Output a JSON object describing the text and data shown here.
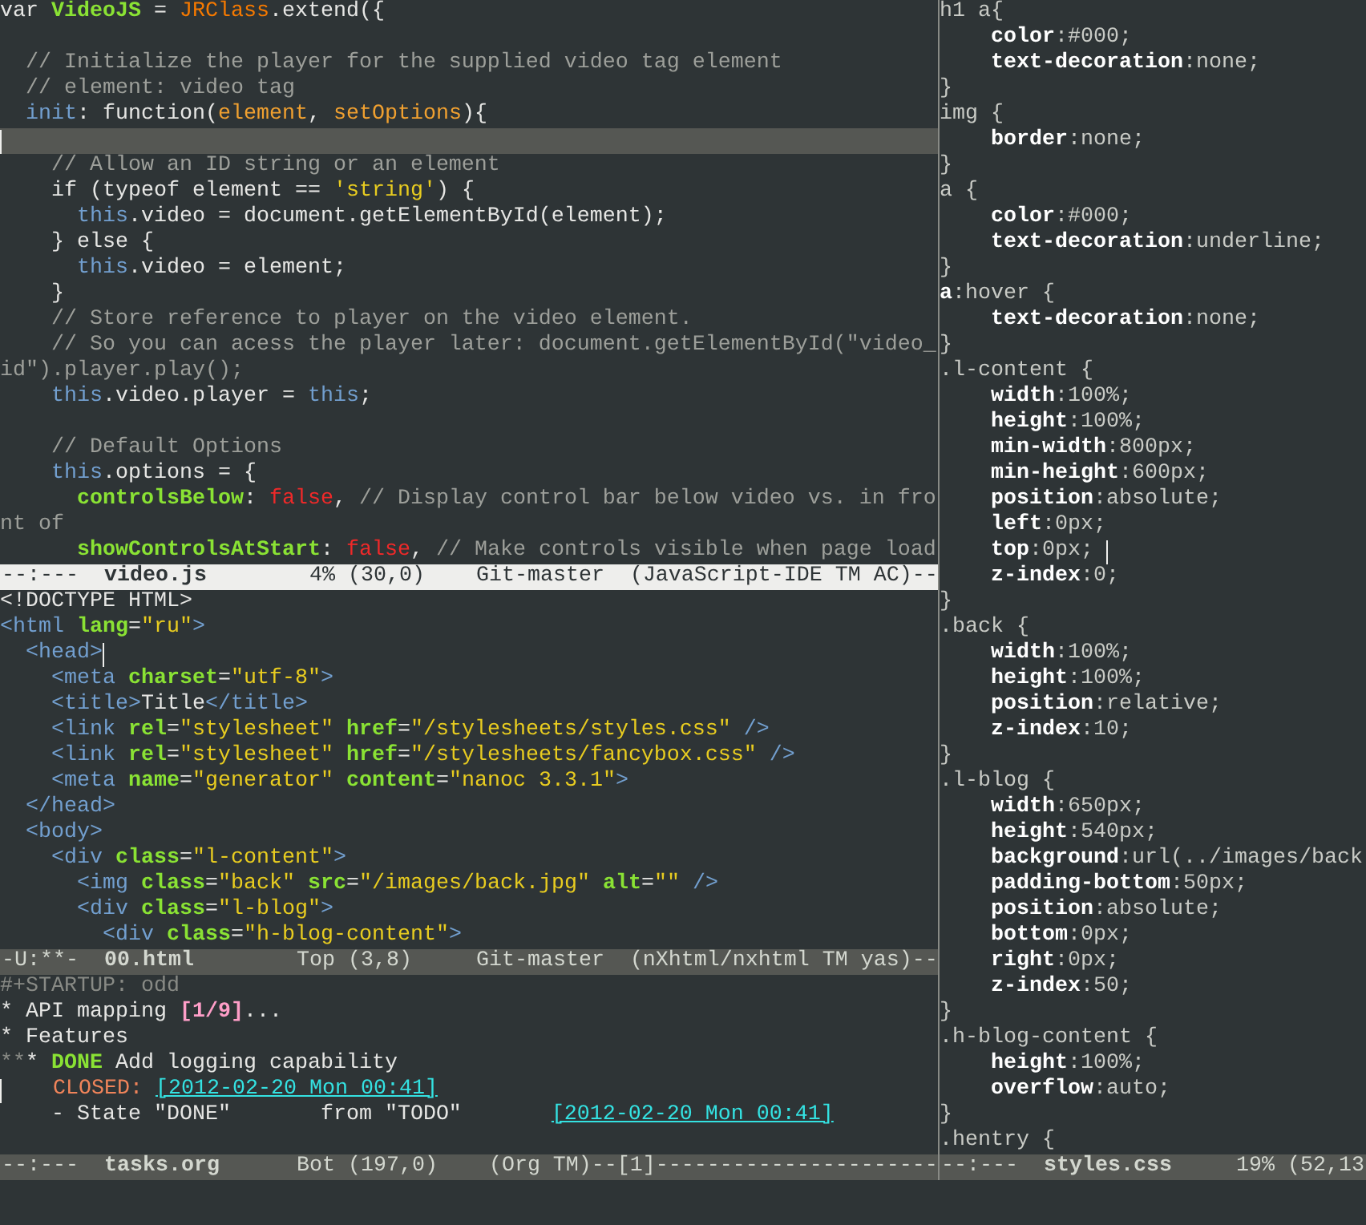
{
  "left_column": [
    {
      "lines": [
        {
          "kind": "code",
          "segments": [
            {
              "kind": "plain",
              "text": "var "
            },
            {
              "kind": "name",
              "text": "VideoJS"
            },
            {
              "kind": "plain",
              "text": " = "
            },
            {
              "kind": "type",
              "text": "JRClass"
            },
            {
              "kind": "plain",
              "text": ".extend({"
            }
          ]
        },
        {
          "kind": "blank"
        },
        {
          "kind": "code",
          "segments": [
            {
              "kind": "comment",
              "text": "  // Initialize the player for the supplied video tag element"
            }
          ]
        },
        {
          "kind": "code",
          "segments": [
            {
              "kind": "comment",
              "text": "  // element: video tag"
            }
          ]
        },
        {
          "kind": "code",
          "segments": [
            {
              "kind": "keyword",
              "text": "  init"
            },
            {
              "kind": "plain",
              "text": ": function("
            },
            {
              "kind": "param",
              "text": "element"
            },
            {
              "kind": "plain",
              "text": ", "
            },
            {
              "kind": "param",
              "text": "setOptions"
            },
            {
              "kind": "plain",
              "text": "){"
            }
          ]
        },
        {
          "kind": "current",
          "segments": [
            {
              "kind": "cursor"
            }
          ]
        },
        {
          "kind": "code",
          "segments": [
            {
              "kind": "comment",
              "text": "    // Allow an ID string or an element"
            }
          ]
        },
        {
          "kind": "code",
          "segments": [
            {
              "kind": "plain",
              "text": "    if (typeof element == "
            },
            {
              "kind": "string",
              "text": "'string'"
            },
            {
              "kind": "plain",
              "text": ") {"
            }
          ]
        },
        {
          "kind": "code",
          "segments": [
            {
              "kind": "keyword",
              "text": "      this"
            },
            {
              "kind": "plain",
              "text": ".video = document.getElementById(element);"
            }
          ]
        },
        {
          "kind": "code",
          "segments": [
            {
              "kind": "plain",
              "text": "    } else {"
            }
          ]
        },
        {
          "kind": "code",
          "segments": [
            {
              "kind": "keyword",
              "text": "      this"
            },
            {
              "kind": "plain",
              "text": ".video = element;"
            }
          ]
        },
        {
          "kind": "code",
          "segments": [
            {
              "kind": "plain",
              "text": "    }"
            }
          ]
        },
        {
          "kind": "code",
          "segments": [
            {
              "kind": "comment",
              "text": "    // Store reference to player on the video element."
            }
          ]
        },
        {
          "kind": "code",
          "segments": [
            {
              "kind": "comment",
              "text": "    // So you can acess the player later: document.getElementById(\"video_"
            }
          ]
        },
        {
          "kind": "code",
          "segments": [
            {
              "kind": "comment",
              "text": "id\").player.play();"
            }
          ]
        },
        {
          "kind": "code",
          "segments": [
            {
              "kind": "keyword",
              "text": "    this"
            },
            {
              "kind": "plain",
              "text": ".video.player = "
            },
            {
              "kind": "keyword",
              "text": "this"
            },
            {
              "kind": "plain",
              "text": ";"
            }
          ]
        },
        {
          "kind": "blank"
        },
        {
          "kind": "code",
          "segments": [
            {
              "kind": "comment",
              "text": "    // Default Options"
            }
          ]
        },
        {
          "kind": "code",
          "segments": [
            {
              "kind": "keyword",
              "text": "    this"
            },
            {
              "kind": "plain",
              "text": ".options = {"
            }
          ]
        },
        {
          "kind": "code",
          "segments": [
            {
              "kind": "name",
              "text": "      controlsBelow"
            },
            {
              "kind": "plain",
              "text": ": "
            },
            {
              "kind": "constant",
              "text": "false"
            },
            {
              "kind": "plain",
              "text": ", "
            },
            {
              "kind": "comment",
              "text": "// Display control bar below video vs. in fro"
            }
          ]
        },
        {
          "kind": "code",
          "segments": [
            {
              "kind": "comment",
              "text": "nt of"
            }
          ]
        },
        {
          "kind": "code",
          "segments": [
            {
              "kind": "name",
              "text": "      showControlsAtStart"
            },
            {
              "kind": "plain",
              "text": ": "
            },
            {
              "kind": "constant",
              "text": "false"
            },
            {
              "kind": "plain",
              "text": ", "
            },
            {
              "kind": "comment",
              "text": "// Make controls visible when page load"
            }
          ]
        }
      ],
      "mode_line": {
        "status": "--:---",
        "buffer": "video.js",
        "info": "        4% (30,0)    Git-master  (JavaScript-IDE TM AC)--",
        "active": true
      }
    },
    {
      "lines": [
        {
          "kind": "code",
          "segments": [
            {
              "kind": "plain",
              "text": "<!DOCTYPE HTML>"
            }
          ]
        },
        {
          "kind": "code",
          "segments": [
            {
              "kind": "tag",
              "text": "<html "
            },
            {
              "kind": "attr",
              "text": "lang"
            },
            {
              "kind": "plain",
              "text": "="
            },
            {
              "kind": "string",
              "text": "\"ru\""
            },
            {
              "kind": "tag",
              "text": ">"
            }
          ]
        },
        {
          "kind": "code",
          "segments": [
            {
              "kind": "tag",
              "text": "  <head>"
            },
            {
              "kind": "cursor"
            }
          ]
        },
        {
          "kind": "code",
          "segments": [
            {
              "kind": "tag",
              "text": "    <meta "
            },
            {
              "kind": "attr",
              "text": "charset"
            },
            {
              "kind": "plain",
              "text": "="
            },
            {
              "kind": "string",
              "text": "\"utf-8\""
            },
            {
              "kind": "tag",
              "text": ">"
            }
          ]
        },
        {
          "kind": "code",
          "segments": [
            {
              "kind": "tag",
              "text": "    <title>"
            },
            {
              "kind": "plain",
              "text": "Title"
            },
            {
              "kind": "tag",
              "text": "</title>"
            }
          ]
        },
        {
          "kind": "code",
          "segments": [
            {
              "kind": "tag",
              "text": "    <link "
            },
            {
              "kind": "attr",
              "text": "rel"
            },
            {
              "kind": "plain",
              "text": "="
            },
            {
              "kind": "string",
              "text": "\"stylesheet\" "
            },
            {
              "kind": "attr",
              "text": "href"
            },
            {
              "kind": "plain",
              "text": "="
            },
            {
              "kind": "string",
              "text": "\"/stylesheets/styles.css\" "
            },
            {
              "kind": "tag",
              "text": "/>"
            }
          ]
        },
        {
          "kind": "code",
          "segments": [
            {
              "kind": "tag",
              "text": "    <link "
            },
            {
              "kind": "attr",
              "text": "rel"
            },
            {
              "kind": "plain",
              "text": "="
            },
            {
              "kind": "string",
              "text": "\"stylesheet\" "
            },
            {
              "kind": "attr",
              "text": "href"
            },
            {
              "kind": "plain",
              "text": "="
            },
            {
              "kind": "string",
              "text": "\"/stylesheets/fancybox.css\" "
            },
            {
              "kind": "tag",
              "text": "/>"
            }
          ]
        },
        {
          "kind": "code",
          "segments": [
            {
              "kind": "tag",
              "text": "    <meta "
            },
            {
              "kind": "attr",
              "text": "name"
            },
            {
              "kind": "plain",
              "text": "="
            },
            {
              "kind": "string",
              "text": "\"generator\" "
            },
            {
              "kind": "attr",
              "text": "content"
            },
            {
              "kind": "plain",
              "text": "="
            },
            {
              "kind": "string",
              "text": "\"nanoc 3.3.1\""
            },
            {
              "kind": "tag",
              "text": ">"
            }
          ]
        },
        {
          "kind": "code",
          "segments": [
            {
              "kind": "tag",
              "text": "  </head>"
            }
          ]
        },
        {
          "kind": "code",
          "segments": [
            {
              "kind": "tag",
              "text": "  <body>"
            }
          ]
        },
        {
          "kind": "code",
          "segments": [
            {
              "kind": "tag",
              "text": "    <div "
            },
            {
              "kind": "attr",
              "text": "class"
            },
            {
              "kind": "plain",
              "text": "="
            },
            {
              "kind": "string",
              "text": "\"l-content\""
            },
            {
              "kind": "tag",
              "text": ">"
            }
          ]
        },
        {
          "kind": "code",
          "segments": [
            {
              "kind": "tag",
              "text": "      <img "
            },
            {
              "kind": "attr",
              "text": "class"
            },
            {
              "kind": "plain",
              "text": "="
            },
            {
              "kind": "string",
              "text": "\"back\" "
            },
            {
              "kind": "attr",
              "text": "src"
            },
            {
              "kind": "plain",
              "text": "="
            },
            {
              "kind": "string",
              "text": "\"/images/back.jpg\" "
            },
            {
              "kind": "attr",
              "text": "alt"
            },
            {
              "kind": "plain",
              "text": "="
            },
            {
              "kind": "string",
              "text": "\"\" "
            },
            {
              "kind": "tag",
              "text": "/>"
            }
          ]
        },
        {
          "kind": "code",
          "segments": [
            {
              "kind": "tag",
              "text": "      <div "
            },
            {
              "kind": "attr",
              "text": "class"
            },
            {
              "kind": "plain",
              "text": "="
            },
            {
              "kind": "string",
              "text": "\"l-blog\""
            },
            {
              "kind": "tag",
              "text": ">"
            }
          ]
        },
        {
          "kind": "code",
          "segments": [
            {
              "kind": "tag",
              "text": "        <div "
            },
            {
              "kind": "attr",
              "text": "class"
            },
            {
              "kind": "plain",
              "text": "="
            },
            {
              "kind": "string",
              "text": "\"h-blog-content\""
            },
            {
              "kind": "tag",
              "text": ">"
            }
          ]
        }
      ],
      "mode_line": {
        "status": "-U:**-",
        "buffer": "00.html",
        "info": "        Top (3,8)     Git-master  (nXhtml/nxhtml TM yas)--",
        "active": false
      }
    },
    {
      "lines": [
        {
          "kind": "code",
          "segments": [
            {
              "kind": "meta",
              "text": "#+STARTUP: odd"
            }
          ]
        },
        {
          "kind": "code",
          "segments": [
            {
              "kind": "plain",
              "text": "* API mapping "
            },
            {
              "kind": "count",
              "text": "[1/9]"
            },
            {
              "kind": "plain",
              "text": "..."
            }
          ]
        },
        {
          "kind": "code",
          "segments": [
            {
              "kind": "plain",
              "text": "* Features"
            }
          ]
        },
        {
          "kind": "code",
          "segments": [
            {
              "kind": "dim",
              "text": "**"
            },
            {
              "kind": "plain",
              "text": "* "
            },
            {
              "kind": "done",
              "text": "DONE"
            },
            {
              "kind": "plain",
              "text": " Add logging capability"
            }
          ]
        },
        {
          "kind": "code",
          "segments": [
            {
              "kind": "cursor"
            },
            {
              "kind": "closed",
              "text": "    CLOSED: "
            },
            {
              "kind": "stamp",
              "text": "[2012-02-20 Mon 00:41]"
            }
          ]
        },
        {
          "kind": "code",
          "segments": [
            {
              "kind": "plain",
              "text": "    - State \"DONE\"       from \"TODO\"       "
            },
            {
              "kind": "stamp",
              "text": "[2012-02-20 Mon 00:41]"
            }
          ]
        }
      ],
      "mode_line": {
        "status": "--:---",
        "buffer": "tasks.org",
        "info": "      Bot (197,0)    (Org TM)--[1]----------------------",
        "active": false
      }
    }
  ],
  "right_column": [
    {
      "lines": [
        {
          "kind": "code",
          "segments": [
            {
              "kind": "plain",
              "text": "h1 a{"
            }
          ]
        },
        {
          "kind": "code",
          "segments": [
            {
              "kind": "prop",
              "text": "    color"
            },
            {
              "kind": "plain",
              "text": ":#000;"
            }
          ]
        },
        {
          "kind": "code",
          "segments": [
            {
              "kind": "prop",
              "text": "    text-decoration"
            },
            {
              "kind": "plain",
              "text": ":none;"
            }
          ]
        },
        {
          "kind": "code",
          "segments": [
            {
              "kind": "plain",
              "text": "}"
            }
          ]
        },
        {
          "kind": "code",
          "segments": [
            {
              "kind": "plain",
              "text": "img {"
            }
          ]
        },
        {
          "kind": "code",
          "segments": [
            {
              "kind": "prop",
              "text": "    border"
            },
            {
              "kind": "plain",
              "text": ":none;"
            }
          ]
        },
        {
          "kind": "code",
          "segments": [
            {
              "kind": "plain",
              "text": "}"
            }
          ]
        },
        {
          "kind": "code",
          "segments": [
            {
              "kind": "plain",
              "text": "a {"
            }
          ]
        },
        {
          "kind": "code",
          "segments": [
            {
              "kind": "prop",
              "text": "    color"
            },
            {
              "kind": "plain",
              "text": ":#000;"
            }
          ]
        },
        {
          "kind": "code",
          "segments": [
            {
              "kind": "prop",
              "text": "    text-decoration"
            },
            {
              "kind": "plain",
              "text": ":underline;"
            }
          ]
        },
        {
          "kind": "code",
          "segments": [
            {
              "kind": "plain",
              "text": "}"
            }
          ]
        },
        {
          "kind": "code",
          "segments": [
            {
              "kind": "prop",
              "text": "a"
            },
            {
              "kind": "plain",
              "text": ":hover {"
            }
          ]
        },
        {
          "kind": "code",
          "segments": [
            {
              "kind": "prop",
              "text": "    text-decoration"
            },
            {
              "kind": "plain",
              "text": ":none;"
            }
          ]
        },
        {
          "kind": "code",
          "segments": [
            {
              "kind": "plain",
              "text": "}"
            }
          ]
        },
        {
          "kind": "code",
          "segments": [
            {
              "kind": "plain",
              "text": ".l-content {"
            }
          ]
        },
        {
          "kind": "code",
          "segments": [
            {
              "kind": "prop",
              "text": "    width"
            },
            {
              "kind": "plain",
              "text": ":100%;"
            }
          ]
        },
        {
          "kind": "code",
          "segments": [
            {
              "kind": "prop",
              "text": "    height"
            },
            {
              "kind": "plain",
              "text": ":100%;"
            }
          ]
        },
        {
          "kind": "code",
          "segments": [
            {
              "kind": "prop",
              "text": "    min-width"
            },
            {
              "kind": "plain",
              "text": ":800px;"
            }
          ]
        },
        {
          "kind": "code",
          "segments": [
            {
              "kind": "prop",
              "text": "    min-height"
            },
            {
              "kind": "plain",
              "text": ":600px;"
            }
          ]
        },
        {
          "kind": "code",
          "segments": [
            {
              "kind": "prop",
              "text": "    position"
            },
            {
              "kind": "plain",
              "text": ":absolute;"
            }
          ]
        },
        {
          "kind": "code",
          "segments": [
            {
              "kind": "prop",
              "text": "    left"
            },
            {
              "kind": "plain",
              "text": ":0px;"
            }
          ]
        },
        {
          "kind": "code",
          "segments": [
            {
              "kind": "prop",
              "text": "    top"
            },
            {
              "kind": "plain",
              "text": ":0px; "
            },
            {
              "kind": "cursor"
            }
          ]
        },
        {
          "kind": "code",
          "segments": [
            {
              "kind": "prop",
              "text": "    z-index"
            },
            {
              "kind": "plain",
              "text": ":0;"
            }
          ]
        },
        {
          "kind": "code",
          "segments": [
            {
              "kind": "plain",
              "text": "}"
            }
          ]
        },
        {
          "kind": "code",
          "segments": [
            {
              "kind": "plain",
              "text": ".back {"
            }
          ]
        },
        {
          "kind": "code",
          "segments": [
            {
              "kind": "prop",
              "text": "    width"
            },
            {
              "kind": "plain",
              "text": ":100%;"
            }
          ]
        },
        {
          "kind": "code",
          "segments": [
            {
              "kind": "prop",
              "text": "    height"
            },
            {
              "kind": "plain",
              "text": ":100%;"
            }
          ]
        },
        {
          "kind": "code",
          "segments": [
            {
              "kind": "prop",
              "text": "    position"
            },
            {
              "kind": "plain",
              "text": ":relative;"
            }
          ]
        },
        {
          "kind": "code",
          "segments": [
            {
              "kind": "prop",
              "text": "    z-index"
            },
            {
              "kind": "plain",
              "text": ":10;"
            }
          ]
        },
        {
          "kind": "code",
          "segments": [
            {
              "kind": "plain",
              "text": "}"
            }
          ]
        },
        {
          "kind": "code",
          "segments": [
            {
              "kind": "plain",
              "text": ".l-blog {"
            }
          ]
        },
        {
          "kind": "code",
          "segments": [
            {
              "kind": "prop",
              "text": "    width"
            },
            {
              "kind": "plain",
              "text": ":650px;"
            }
          ]
        },
        {
          "kind": "code",
          "segments": [
            {
              "kind": "prop",
              "text": "    height"
            },
            {
              "kind": "plain",
              "text": ":540px;"
            }
          ]
        },
        {
          "kind": "code",
          "segments": [
            {
              "kind": "prop",
              "text": "    background"
            },
            {
              "kind": "plain",
              "text": ":url(../images/back"
            }
          ]
        },
        {
          "kind": "code",
          "segments": [
            {
              "kind": "prop",
              "text": "    padding-bottom"
            },
            {
              "kind": "plain",
              "text": ":50px;"
            }
          ]
        },
        {
          "kind": "code",
          "segments": [
            {
              "kind": "prop",
              "text": "    position"
            },
            {
              "kind": "plain",
              "text": ":absolute;"
            }
          ]
        },
        {
          "kind": "code",
          "segments": [
            {
              "kind": "prop",
              "text": "    bottom"
            },
            {
              "kind": "plain",
              "text": ":0px;"
            }
          ]
        },
        {
          "kind": "code",
          "segments": [
            {
              "kind": "prop",
              "text": "    right"
            },
            {
              "kind": "plain",
              "text": ":0px;"
            }
          ]
        },
        {
          "kind": "code",
          "segments": [
            {
              "kind": "prop",
              "text": "    z-index"
            },
            {
              "kind": "plain",
              "text": ":50;"
            }
          ]
        },
        {
          "kind": "code",
          "segments": [
            {
              "kind": "plain",
              "text": "}"
            }
          ]
        },
        {
          "kind": "code",
          "segments": [
            {
              "kind": "plain",
              "text": ".h-blog-content {"
            }
          ]
        },
        {
          "kind": "code",
          "segments": [
            {
              "kind": "prop",
              "text": "    height"
            },
            {
              "kind": "plain",
              "text": ":100%;"
            }
          ]
        },
        {
          "kind": "code",
          "segments": [
            {
              "kind": "prop",
              "text": "    overflow"
            },
            {
              "kind": "plain",
              "text": ":auto;"
            }
          ]
        },
        {
          "kind": "code",
          "segments": [
            {
              "kind": "plain",
              "text": "}"
            }
          ]
        },
        {
          "kind": "code",
          "segments": [
            {
              "kind": "plain",
              "text": ".hentry {"
            }
          ]
        }
      ],
      "mode_line": {
        "status": "--:---",
        "buffer": "styles.css",
        "info": "     19% (52,13",
        "active": false
      }
    }
  ]
}
